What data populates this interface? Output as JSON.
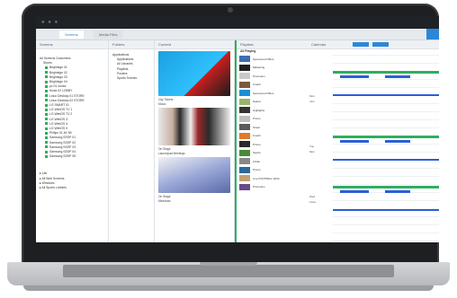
{
  "app": {
    "tabs": [
      "Screens",
      "Media Files"
    ]
  },
  "panels": {
    "screens": {
      "title": "Screens",
      "group_label": "All Screens Customers",
      "sub_label": "Stores",
      "items": [
        "Brightsign 01",
        "Brightsign 02",
        "Brightsign 03",
        "Brightsign 04",
        "pc 01 shoes",
        "Kiosk 02 LOBBY",
        "Linux Desktop 01 STORE",
        "Linux Desktop 02 STORE",
        "LG SMART 01",
        "LG WebOS TV 1",
        "LG WebOS TV 2",
        "LG WebOS 3",
        "LG WebOS 4",
        "LG WebOS 5",
        "Philips 01 4K 55",
        "Samsung SSSP 01",
        "Samsung SSSP 02",
        "Samsung SSSP 03",
        "Samsung SSSP 04",
        "Samsung SSSP 05"
      ],
      "footer": [
        "Lab",
        "All Web Screens",
        "Windows",
        "All Sports Lobbies"
      ],
      "status_color": "#2fae5f"
    },
    "folders": {
      "title": "Folders",
      "items": [
        "Applications",
        "Applications",
        "All Libraries",
        "Playlists",
        "Posters",
        "Sports Scenes"
      ]
    },
    "media": {
      "title": "Content",
      "cards": [
        {
          "caption": "City Tickets",
          "sub": "Music"
        },
        {
          "caption": "On Stage",
          "sub": "Launchpad Meetings"
        },
        {
          "caption": "On Stage",
          "sub": "Meadows"
        }
      ]
    },
    "playlist": {
      "title": "Playlists",
      "header_label": "All Playing",
      "accent": "#2fae5f",
      "items": [
        "Sponsored Offers",
        "Marketing",
        "Promotion",
        "Coach",
        "Sponsored Offers",
        "Nature",
        "Highlights",
        "Promo",
        "Street",
        "Coach",
        "Promo",
        "Sports",
        "Urban",
        "Promo",
        "Live FOOTBALL 2019",
        "Promotion"
      ]
    },
    "calendar": {
      "title": "Calendar",
      "btn_a": "Today",
      "btn_b": "Week",
      "days": [
        "Mon",
        "Tue",
        "Wed"
      ],
      "time_labels": [
        "7am",
        "9am",
        "11am",
        "1pm"
      ],
      "bar_colors": {
        "green": "#2fae5f",
        "blue": "#2b5fd8"
      }
    }
  },
  "header": {
    "user": "Admin"
  }
}
